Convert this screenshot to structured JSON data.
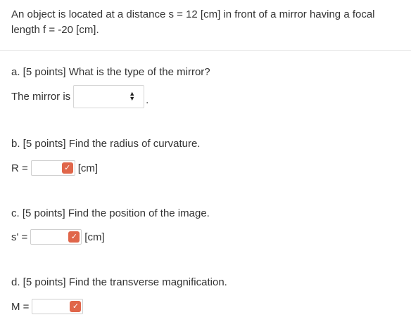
{
  "problem": {
    "intro_line1": "An object is located at a distance s = 12 [cm] in front of a mirror having a focal",
    "intro_line2": "length f = -20 [cm]."
  },
  "parts": {
    "a": {
      "question": "a.  [5 points] What is the type of the mirror?",
      "prompt": "The mirror is",
      "selected": "",
      "suffix": "."
    },
    "b": {
      "question": "b.  [5 points] Find the radius of curvature.",
      "label": "R =",
      "value": "",
      "unit": "[cm]"
    },
    "c": {
      "question": "c.  [5 points] Find the position of the image.",
      "label": "s' =",
      "value": "",
      "unit": "[cm]"
    },
    "d": {
      "question": "d. [5 points] Find the transverse magnification.",
      "label": "M =",
      "value": ""
    }
  },
  "icons": {
    "select_arrows": "up-down-arrows-icon",
    "answer_status": "check-badge-icon"
  },
  "colors": {
    "badge": "#e0664a",
    "text": "#333333",
    "border": "#cfcfcf"
  }
}
